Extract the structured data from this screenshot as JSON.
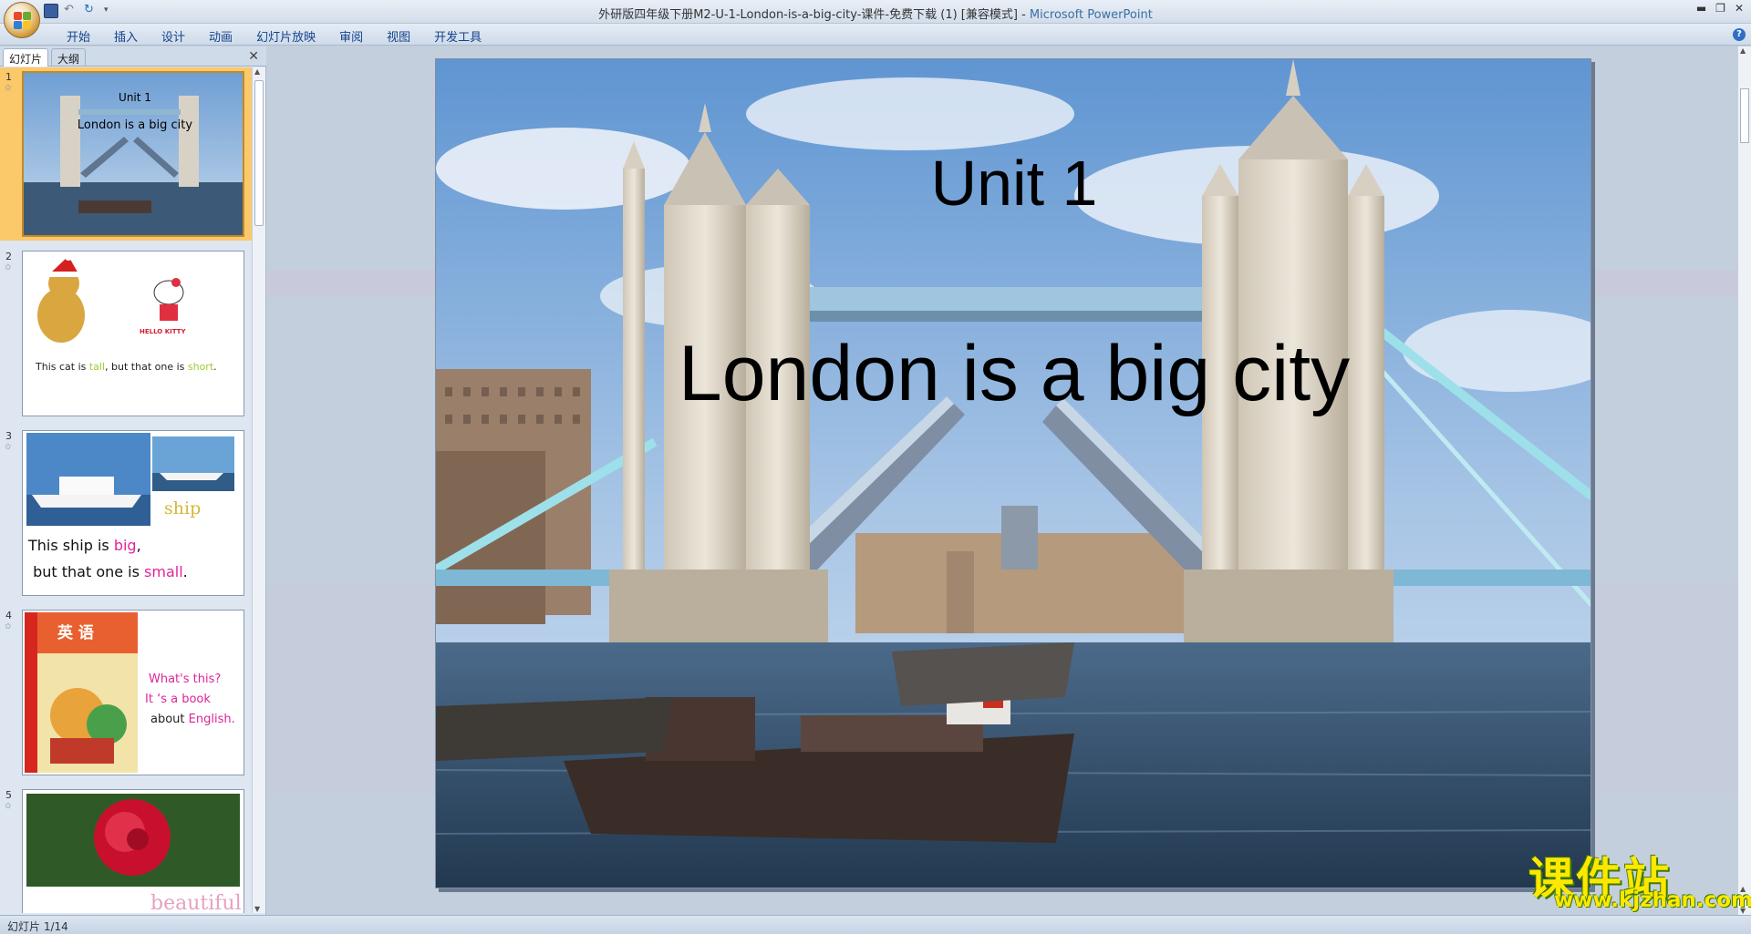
{
  "window": {
    "title_doc": "外研版四年级下册M2-U-1-London-is-a-big-city-课件-免费下载 (1) [兼容模式]",
    "title_sep": " - ",
    "title_app": "Microsoft PowerPoint"
  },
  "menu": {
    "tabs": [
      "开始",
      "插入",
      "设计",
      "动画",
      "幻灯片放映",
      "审阅",
      "视图",
      "开发工具"
    ]
  },
  "panel": {
    "tab_slides": "幻灯片",
    "tab_outline": "大纲",
    "close": "✕"
  },
  "thumbs": [
    {
      "num": "1",
      "title": "Unit 1",
      "subtitle": "London is a big city"
    },
    {
      "num": "2",
      "cat_label": "This cat is ",
      "cat_word1": "tall",
      "cat_mid": ", but that one is ",
      "cat_word2": "short",
      "cat_end": ".",
      "kitty": "HELLO KITTY"
    },
    {
      "num": "3",
      "word": "ship",
      "line1_a": "This ship is ",
      "line1_b": "big",
      "line1_c": ",",
      "line2_a": " but that one is ",
      "line2_b": "small",
      "line2_c": "."
    },
    {
      "num": "4",
      "book_title": "英 语",
      "q": "What's this?",
      "a1": "It ‘s a book",
      "a2_a": "about ",
      "a2_b": "English."
    },
    {
      "num": "5",
      "word": "beautiful"
    }
  ],
  "slide": {
    "title": "Unit 1",
    "subtitle": "London is a big city"
  },
  "status": {
    "text": "幻灯片 1/14"
  },
  "watermark": {
    "cn": "课件站",
    "url": "www.kjzhan.com"
  },
  "colors": {
    "accent_green": "#9acd32",
    "accent_pink": "#e0249a",
    "brand_blue": "#3b6ea5"
  }
}
